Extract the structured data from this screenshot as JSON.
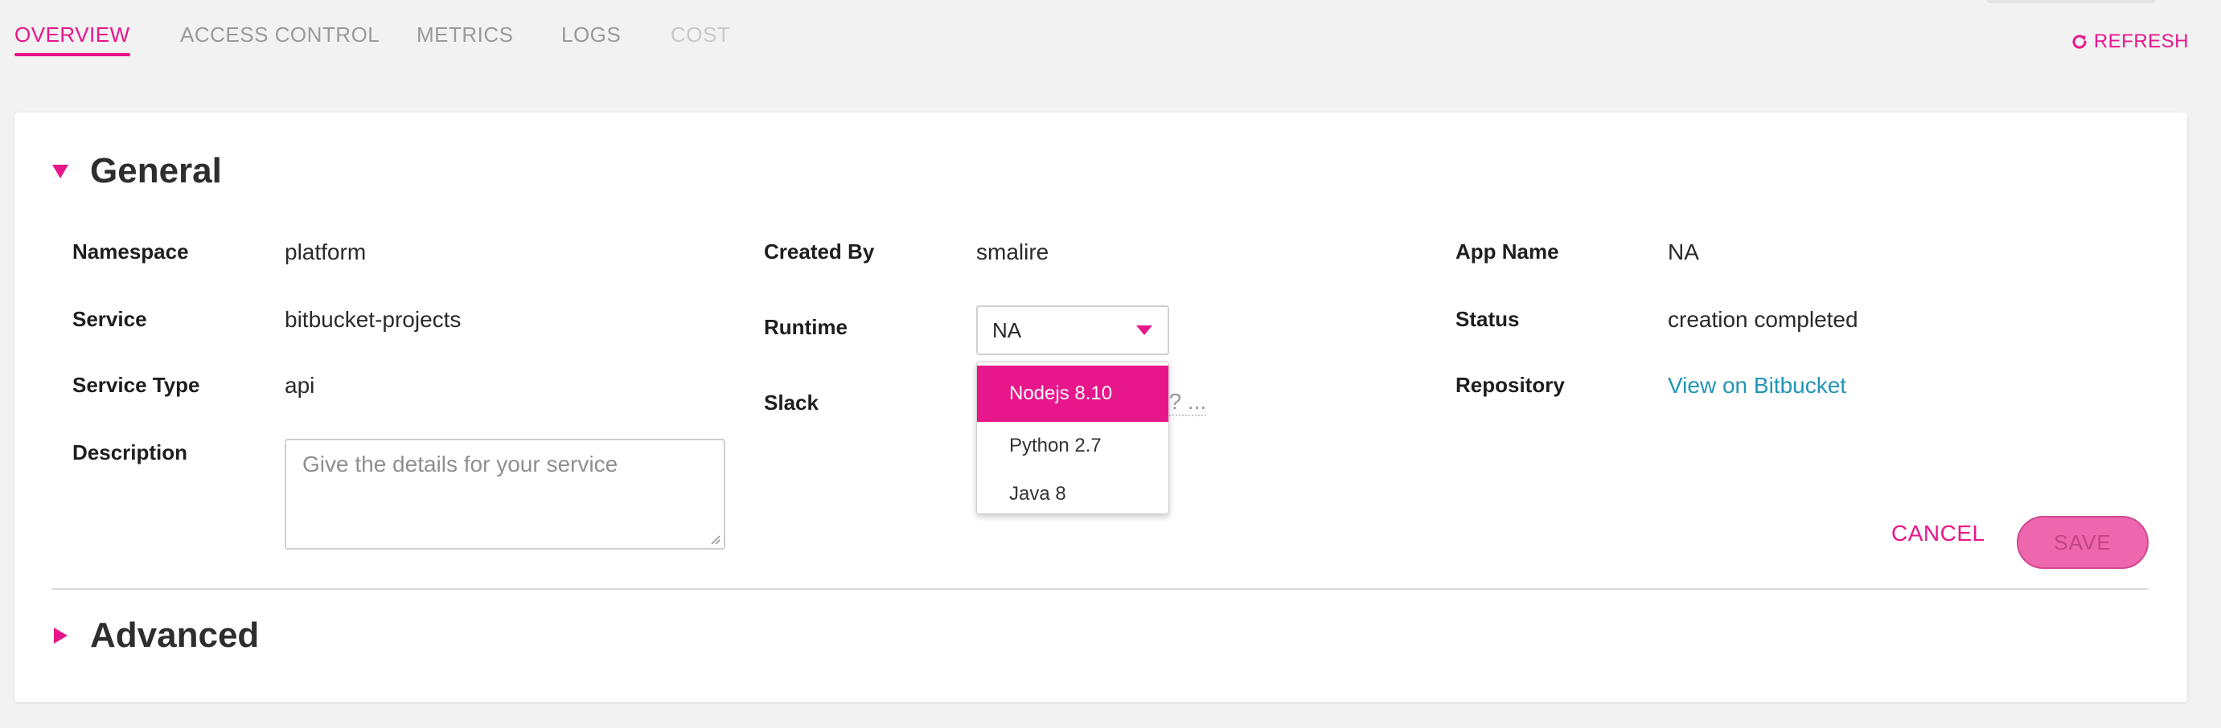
{
  "tabs": [
    {
      "label": "OVERVIEW",
      "state": "active"
    },
    {
      "label": "ACCESS CONTROL",
      "state": "normal"
    },
    {
      "label": "METRICS",
      "state": "normal"
    },
    {
      "label": "LOGS",
      "state": "normal"
    },
    {
      "label": "COST",
      "state": "disabled"
    }
  ],
  "header": {
    "refresh_label": "REFRESH",
    "refresh_icon": "refresh-icon"
  },
  "general": {
    "title": "General",
    "fields": {
      "namespace": {
        "label": "Namespace",
        "value": "platform"
      },
      "service": {
        "label": "Service",
        "value": "bitbucket-projects"
      },
      "service_type": {
        "label": "Service Type",
        "value": "api"
      },
      "description": {
        "label": "Description",
        "placeholder": "Give the details for your service",
        "value": ""
      },
      "created_by": {
        "label": "Created By",
        "value": "smalire"
      },
      "runtime": {
        "label": "Runtime",
        "selected": "NA",
        "options": [
          "Nodejs 8.10",
          "Python 2.7",
          "Java 8"
        ],
        "highlighted": "Nodejs 8.10"
      },
      "slack": {
        "label": "Slack",
        "visible_hint": "e? ..."
      },
      "app_name": {
        "label": "App Name",
        "value": "NA"
      },
      "status": {
        "label": "Status",
        "value": "creation completed"
      },
      "repository": {
        "label": "Repository",
        "link_text": "View on Bitbucket"
      }
    }
  },
  "actions": {
    "cancel_label": "CANCEL",
    "save_label": "SAVE"
  },
  "advanced": {
    "title": "Advanced"
  },
  "colors": {
    "accent": "#e8168b",
    "link": "#2196b6",
    "save_bg": "#ee66ad"
  }
}
